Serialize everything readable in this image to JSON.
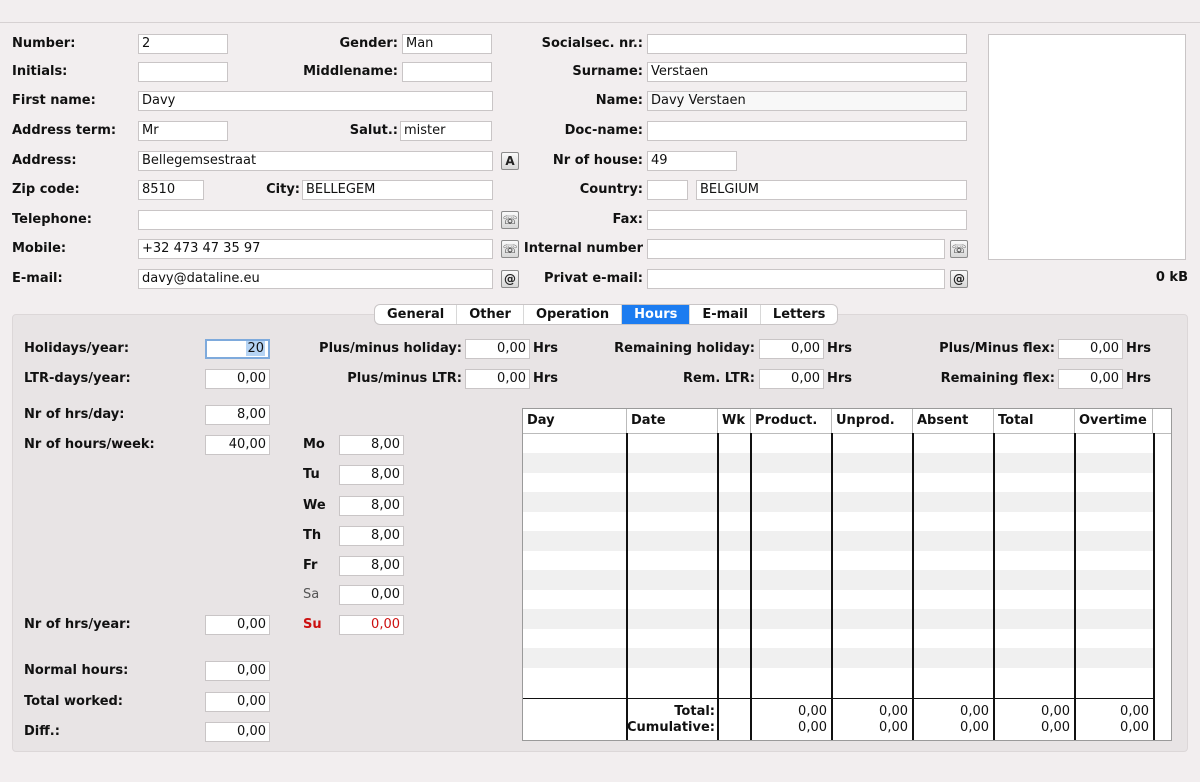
{
  "person": {
    "number": {
      "label": "Number:",
      "value": "2"
    },
    "gender": {
      "label": "Gender:",
      "value": "Man"
    },
    "socialsec": {
      "label": "Socialsec. nr.:",
      "value": ""
    },
    "initials": {
      "label": "Initials:",
      "value": ""
    },
    "middlename": {
      "label": "Middlename:",
      "value": ""
    },
    "surname": {
      "label": "Surname:",
      "value": "Verstaen"
    },
    "firstname": {
      "label": "First name:",
      "value": "Davy"
    },
    "name": {
      "label": "Name:",
      "value": "Davy Verstaen"
    },
    "address_term": {
      "label": "Address term:",
      "value": "Mr"
    },
    "salut": {
      "label": "Salut.:",
      "value": "mister"
    },
    "doc_name": {
      "label": "Doc-name:",
      "value": ""
    },
    "address": {
      "label": "Address:",
      "value": "Bellegemsestraat"
    },
    "nr_of_house": {
      "label": "Nr of house:",
      "value": "49"
    },
    "zip": {
      "label": "Zip code:",
      "value": "8510"
    },
    "city": {
      "label": "City:",
      "value": "BELLEGEM"
    },
    "country": {
      "label": "Country:",
      "code": "",
      "value": "BELGIUM"
    },
    "telephone": {
      "label": "Telephone:",
      "value": ""
    },
    "fax": {
      "label": "Fax:",
      "value": ""
    },
    "mobile": {
      "label": "Mobile:",
      "value": "+32 473 47 35 97"
    },
    "internal": {
      "label": "Internal number",
      "value": ""
    },
    "email": {
      "label": "E-mail:",
      "value": "davy@dataline.eu"
    },
    "privat_email": {
      "label": "Privat e-mail:",
      "value": ""
    },
    "photo_size": "0 kB"
  },
  "icons": {
    "address_btn": "A",
    "phone_btn": "☏",
    "mail_btn": "@"
  },
  "tabs": [
    "General",
    "Other",
    "Operation",
    "Hours",
    "E-mail",
    "Letters"
  ],
  "active_tab": "Hours",
  "hours": {
    "holidays_year": {
      "label": "Holidays/year:",
      "value": "20"
    },
    "ltr_days": {
      "label": "LTR-days/year:",
      "value": "0,00"
    },
    "hrs_day": {
      "label": "Nr of hrs/day:",
      "value": "8,00"
    },
    "hrs_week": {
      "label": "Nr of hours/week:",
      "value": "40,00"
    },
    "hrs_year": {
      "label": "Nr of hrs/year:",
      "value": "0,00"
    },
    "normal_hours": {
      "label": "Normal hours:",
      "value": "0,00"
    },
    "total_worked": {
      "label": "Total worked:",
      "value": "0,00"
    },
    "diff": {
      "label": "Diff.:",
      "value": "0,00"
    },
    "plusminus_holiday": {
      "label": "Plus/minus holiday:",
      "value": "0,00",
      "unit": "Hrs"
    },
    "plusminus_ltr": {
      "label": "Plus/minus LTR:",
      "value": "0,00",
      "unit": "Hrs"
    },
    "remaining_holiday": {
      "label": "Remaining holiday:",
      "value": "0,00",
      "unit": "Hrs"
    },
    "rem_ltr": {
      "label": "Rem. LTR:",
      "value": "0,00",
      "unit": "Hrs"
    },
    "plusminus_flex": {
      "label": "Plus/Minus flex:",
      "value": "0,00",
      "unit": "Hrs"
    },
    "remaining_flex": {
      "label": "Remaining flex:",
      "value": "0,00",
      "unit": "Hrs"
    },
    "days": [
      {
        "label": "Mo",
        "value": "8,00"
      },
      {
        "label": "Tu",
        "value": "8,00"
      },
      {
        "label": "We",
        "value": "8,00"
      },
      {
        "label": "Th",
        "value": "8,00"
      },
      {
        "label": "Fr",
        "value": "8,00"
      },
      {
        "label": "Sa",
        "value": "0,00"
      },
      {
        "label": "Su",
        "value": "0,00"
      }
    ]
  },
  "table": {
    "columns": [
      "Day",
      "Date",
      "Wk",
      "Product.",
      "Unprod.",
      "Absent",
      "Total",
      "Overtime"
    ],
    "total_label": "Total:",
    "cumulative_label": "Cumulative:",
    "totals": [
      "0,00",
      "0,00",
      "0,00",
      "0,00",
      "0,00"
    ],
    "cumulative": [
      "0,00",
      "0,00",
      "0,00",
      "0,00",
      "0,00"
    ]
  }
}
